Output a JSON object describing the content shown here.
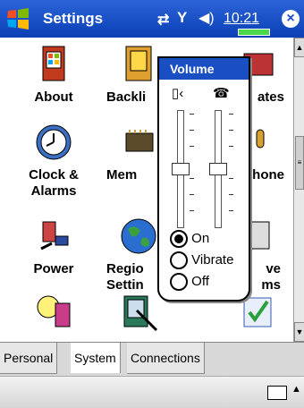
{
  "title_bar": {
    "title": "Settings",
    "clock": "10:21",
    "close_label": "×"
  },
  "icons": [
    {
      "label": "About"
    },
    {
      "label": "Backli"
    },
    {
      "label": "ates"
    },
    {
      "label": "Clock &\nAlarms"
    },
    {
      "label": "Mem"
    },
    {
      "label": "hone"
    },
    {
      "label": "Power"
    },
    {
      "label": "Regio\nSettin"
    },
    {
      "label": "ve\nms"
    }
  ],
  "volume_popup": {
    "title": "Volume",
    "options": [
      {
        "label": "On",
        "selected": true
      },
      {
        "label": "Vibrate",
        "selected": false
      },
      {
        "label": "Off",
        "selected": false
      }
    ],
    "system_volume_level": 0.5,
    "ringer_volume_level": 0.5
  },
  "tabs": [
    {
      "label": "Personal",
      "active": false
    },
    {
      "label": "System",
      "active": true
    },
    {
      "label": "Connections",
      "active": false
    }
  ],
  "colors": {
    "title_bar": "#1a4fc4",
    "battery": "#4cd64c"
  }
}
